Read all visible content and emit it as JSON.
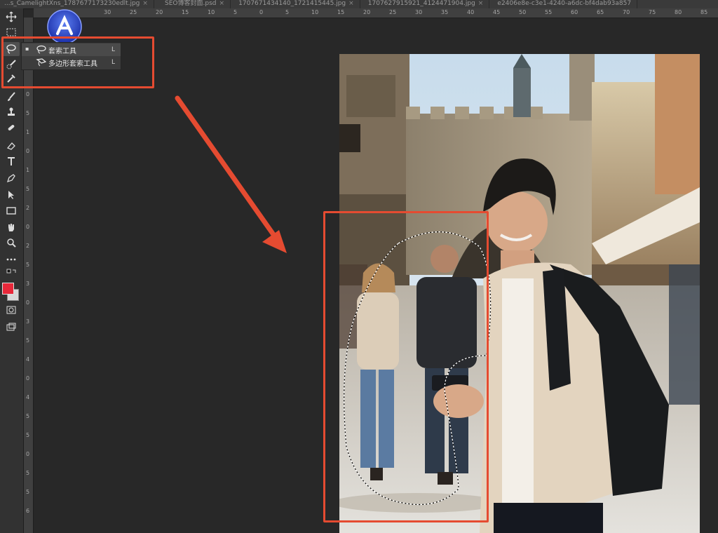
{
  "tabs": [
    {
      "label": "...s_CamelightXns_1787677173230edlt.jpg"
    },
    {
      "label": "SEO博客封面.psd"
    },
    {
      "label": "1707671434140_1721415445.jpg"
    },
    {
      "label": "1707627915921_4124471904.jpg"
    },
    {
      "label": "e2406e8e-c3e1-4240-a6dc-bf4dab93a857"
    }
  ],
  "tab_close_glyph": "×",
  "ruler_top_ticks": [
    "30",
    "25",
    "20",
    "15",
    "10",
    "5",
    "0",
    "5",
    "10",
    "15",
    "20",
    "25",
    "30",
    "35",
    "40",
    "45",
    "50",
    "55",
    "60",
    "65",
    "70",
    "75",
    "80",
    "85"
  ],
  "ruler_left_ticks": [
    "0",
    "5",
    "1",
    "0",
    "1",
    "5",
    "2",
    "0",
    "2",
    "5",
    "3",
    "0",
    "3",
    "5",
    "4",
    "0",
    "4",
    "5",
    "5",
    "0",
    "5",
    "5",
    "6"
  ],
  "flyout": {
    "items": [
      {
        "label": "套索工具",
        "shortcut": "L",
        "icon": "lasso-icon",
        "selected": true
      },
      {
        "label": "多边形套索工具",
        "shortcut": "L",
        "icon": "polygonal-lasso-icon",
        "selected": false
      }
    ],
    "selected_marker": "▪"
  },
  "toolbar": {
    "tools": [
      "move-icon",
      "marquee-icon",
      "lasso-icon",
      "quick-select-icon",
      "eyedropper-icon",
      "brush-icon",
      "stamp-icon",
      "healing-icon",
      "eraser-icon",
      "text-icon",
      "pen-icon",
      "path-select-icon",
      "rectangle-icon",
      "hand-icon",
      "zoom-icon",
      "more-icon"
    ],
    "foreground_color": "#e8283a",
    "background_color": "#d8d8d8"
  },
  "colors": {
    "highlight": "#e54b31",
    "canvas_bg": "#282828"
  }
}
